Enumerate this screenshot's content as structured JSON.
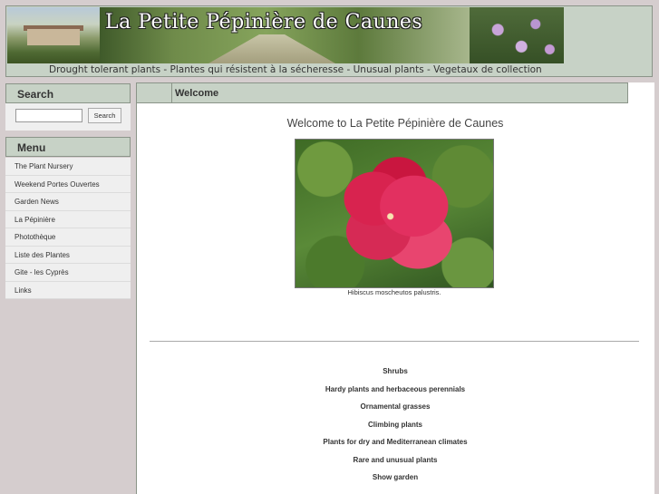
{
  "header": {
    "site_title": "La Petite Pépinière de Caunes",
    "tagline": "Drought tolerant plants - Plantes qui résistent à la sécheresse - Unusual plants - Vegetaux de collection"
  },
  "search": {
    "heading": "Search",
    "input_value": "",
    "button_label": "Search"
  },
  "menu": {
    "heading": "Menu",
    "items": [
      {
        "label": "The Plant Nursery"
      },
      {
        "label": "Weekend Portes Ouvertes"
      },
      {
        "label": "Garden News"
      },
      {
        "label": "La Pépinière"
      },
      {
        "label": "Photothèque"
      },
      {
        "label": "Liste des Plantes"
      },
      {
        "label": "Gite - les Cyprès"
      },
      {
        "label": "Links"
      }
    ]
  },
  "main": {
    "section_title": "Welcome",
    "welcome_text": "Welcome to La Petite Pépinière de Caunes",
    "image_caption": "Hibiscus moscheutos palustris.",
    "categories": [
      {
        "label": "Shrubs"
      },
      {
        "label": "Hardy plants and herbaceous perennials"
      },
      {
        "label": "Ornamental grasses"
      },
      {
        "label": "Climbing plants"
      },
      {
        "label": "Plants for dry and Mediterranean climates"
      },
      {
        "label": "Rare and unusual plants"
      },
      {
        "label": "Show garden"
      }
    ]
  },
  "colors": {
    "page_bg": "#d5cdce",
    "panel_header": "#c7d2c6",
    "content_bg": "#ffffff",
    "flower_red": "#d8234f"
  }
}
